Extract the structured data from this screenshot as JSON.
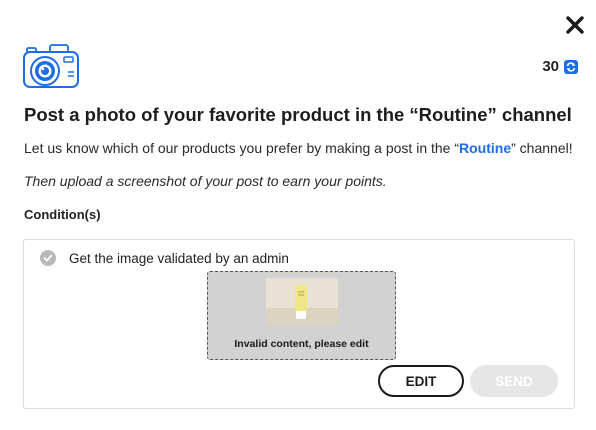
{
  "modal": {
    "points": "30",
    "points_icon": "refresh-token-icon",
    "close_icon": "close-icon",
    "header_icon": "camera-icon",
    "title": "Post a photo of your favorite product in the “Routine” channel",
    "description": {
      "before": "Let us know which of our products you prefer by making a post in the “",
      "channel": "Routine",
      "after": "” channel!"
    },
    "note": "Then upload a screenshot of your post to earn your points.",
    "conditions_label": "Condition(s)"
  },
  "condition": {
    "text": "Get the image validated by an admin",
    "status_icon": "check-circle-icon",
    "preview_status": "Invalid content, please edit"
  },
  "actions": {
    "edit_label": "EDIT",
    "send_label": "SEND"
  },
  "colors": {
    "accent": "#1b6ee6",
    "disabled_button": "#e6e6e6",
    "preview_background": "#d2d2d2"
  }
}
